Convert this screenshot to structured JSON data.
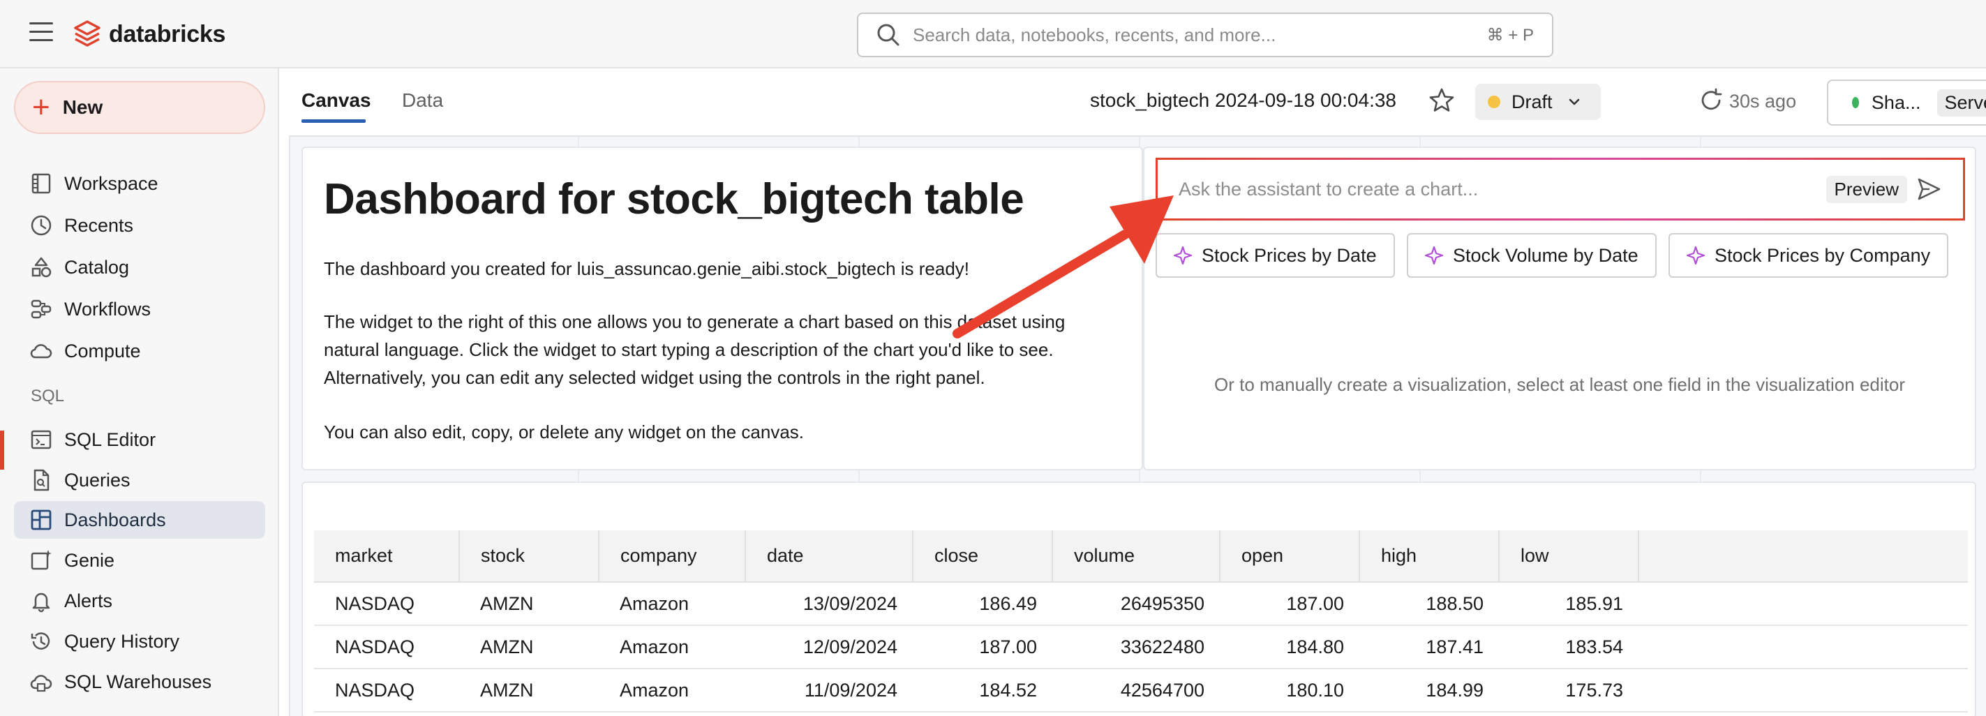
{
  "app": {
    "brand": "databricks",
    "search_placeholder": "Search data, notebooks, recents, and more...",
    "search_shortcut": "⌘ + P"
  },
  "sidebar": {
    "new_label": "New",
    "items": [
      {
        "label": "Workspace",
        "icon": "workspace-icon"
      },
      {
        "label": "Recents",
        "icon": "clock-icon"
      },
      {
        "label": "Catalog",
        "icon": "catalog-icon"
      },
      {
        "label": "Workflows",
        "icon": "workflows-icon"
      },
      {
        "label": "Compute",
        "icon": "cloud-icon"
      }
    ],
    "sql_heading": "SQL",
    "sql_items": [
      {
        "label": "SQL Editor",
        "icon": "sql-editor-icon"
      },
      {
        "label": "Queries",
        "icon": "queries-icon"
      },
      {
        "label": "Dashboards",
        "icon": "dashboards-icon",
        "active": true
      },
      {
        "label": "Genie",
        "icon": "genie-icon"
      },
      {
        "label": "Alerts",
        "icon": "bell-icon"
      },
      {
        "label": "Query History",
        "icon": "history-icon"
      },
      {
        "label": "SQL Warehouses",
        "icon": "warehouse-icon"
      }
    ]
  },
  "header": {
    "tabs": [
      {
        "label": "Canvas",
        "active": true
      },
      {
        "label": "Data",
        "active": false
      }
    ],
    "dashboard_title": "stock_bigtech 2024-09-18 00:04:38",
    "status": "Draft",
    "refresh": "30s ago",
    "share_label": "Sha...",
    "server_label": "Server"
  },
  "text_widget": {
    "heading": "Dashboard for stock_bigtech table",
    "lines": [
      "The dashboard you created for luis_assuncao.genie_aibi.stock_bigtech is ready!",
      "The widget to the right of this one allows you to generate a chart based on this dataset using",
      "natural language. Click the widget to start typing a description of the chart you'd like to see.",
      "Alternatively, you can edit any selected widget using the controls in the right panel.",
      "You can also edit, copy, or delete any widget on the canvas."
    ]
  },
  "ai_widget": {
    "placeholder": "Ask the assistant to create a chart...",
    "preview_label": "Preview",
    "suggestions": [
      "Stock Prices by Date",
      "Stock Volume by Date",
      "Stock Prices by Company"
    ],
    "manual_hint": "Or to manually create a visualization, select at least one field in the visualization editor"
  },
  "table": {
    "columns": [
      "market",
      "stock",
      "company",
      "date",
      "close",
      "volume",
      "open",
      "high",
      "low"
    ],
    "rows": [
      [
        "NASDAQ",
        "AMZN",
        "Amazon",
        "13/09/2024",
        "186.49",
        "26495350",
        "187.00",
        "188.50",
        "185.91"
      ],
      [
        "NASDAQ",
        "AMZN",
        "Amazon",
        "12/09/2024",
        "187.00",
        "33622480",
        "184.80",
        "187.41",
        "183.54"
      ],
      [
        "NASDAQ",
        "AMZN",
        "Amazon",
        "11/09/2024",
        "184.52",
        "42564700",
        "180.10",
        "184.99",
        "175.73"
      ]
    ]
  },
  "colors": {
    "brand": "#e0422d",
    "draft_dot": "#f5c244",
    "share_dot": "#3bb45c",
    "tab_underline": "#2a5fb4",
    "arrow": "#e8402c"
  }
}
